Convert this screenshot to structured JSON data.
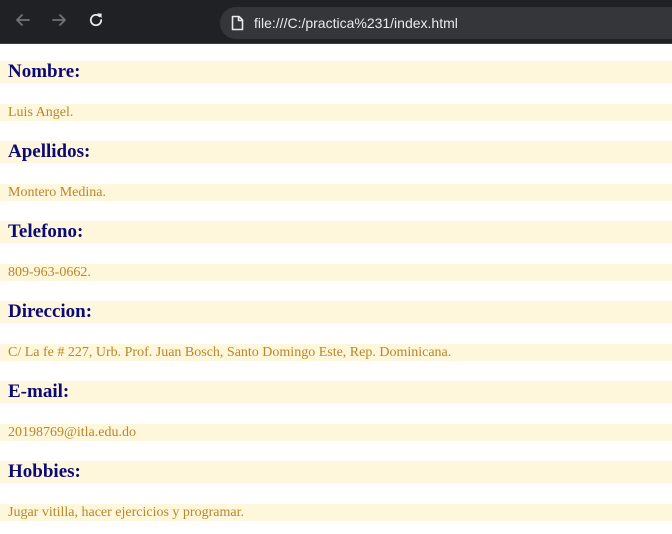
{
  "browser": {
    "url": "file:///C:/practica%231/index.html"
  },
  "fields": [
    {
      "label": "Nombre:",
      "value": "Luis Angel."
    },
    {
      "label": "Apellidos:",
      "value": "Montero Medina."
    },
    {
      "label": "Telefono:",
      "value": "809-963-0662."
    },
    {
      "label": "Direccion:",
      "value": "C/ La fe # 227, Urb. Prof. Juan Bosch, Santo Domingo Este, Rep. Dominicana."
    },
    {
      "label": "E-mail:",
      "value": "20198769@itla.edu.do"
    },
    {
      "label": "Hobbies:",
      "value": "Jugar vitilla, hacer ejercicios y programar."
    }
  ]
}
